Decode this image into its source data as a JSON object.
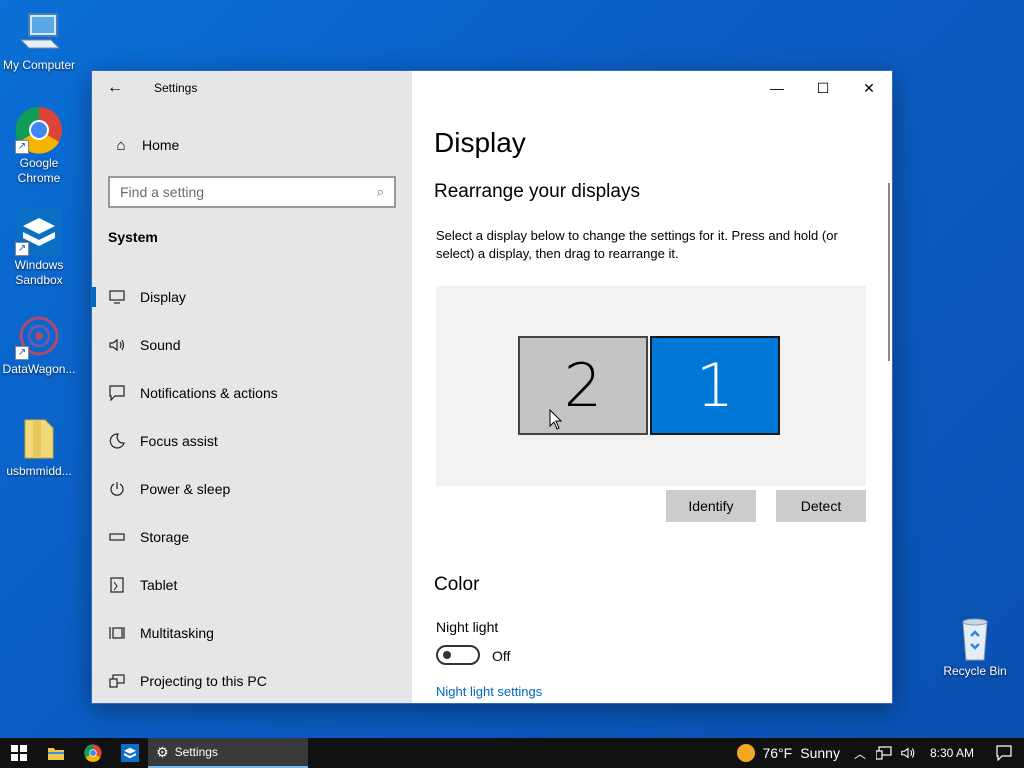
{
  "desktop": {
    "icons": [
      {
        "label": "My Computer"
      },
      {
        "label": "Google Chrome"
      },
      {
        "label": "Windows Sandbox"
      },
      {
        "label": "DataWagon..."
      },
      {
        "label": "usbmmidd..."
      },
      {
        "label": "Recycle Bin"
      }
    ]
  },
  "window": {
    "title": "Settings",
    "controls": {
      "minimize": "—",
      "maximize": "☐",
      "close": "✕"
    }
  },
  "sidebar": {
    "home_label": "Home",
    "search_placeholder": "Find a setting",
    "section": "System",
    "items": [
      {
        "label": "Display",
        "icon": "monitor-icon"
      },
      {
        "label": "Sound",
        "icon": "speaker-icon"
      },
      {
        "label": "Notifications & actions",
        "icon": "notification-icon"
      },
      {
        "label": "Focus assist",
        "icon": "moon-icon"
      },
      {
        "label": "Power & sleep",
        "icon": "power-icon"
      },
      {
        "label": "Storage",
        "icon": "storage-icon"
      },
      {
        "label": "Tablet",
        "icon": "tablet-icon"
      },
      {
        "label": "Multitasking",
        "icon": "multitasking-icon"
      },
      {
        "label": "Projecting to this PC",
        "icon": "projecting-icon"
      }
    ],
    "active_index": 0
  },
  "main": {
    "title": "Display",
    "rearrange_title": "Rearrange your displays",
    "rearrange_desc": "Select a display below to change the settings for it. Press and hold (or select) a display, then drag to rearrange it.",
    "monitors": [
      {
        "number": "2",
        "selected": false
      },
      {
        "number": "1",
        "selected": true
      }
    ],
    "identify_label": "Identify",
    "detect_label": "Detect",
    "color_title": "Color",
    "night_light_label": "Night light",
    "night_light_state": "Off",
    "night_light_link": "Night light settings"
  },
  "taskbar": {
    "app_label": "Settings",
    "weather_temp": "76°F",
    "weather_desc": "Sunny",
    "time": "8:30 AM"
  },
  "colors": {
    "accent": "#0078d7",
    "link": "#0067c0",
    "desktop": "#0a6fd6"
  }
}
